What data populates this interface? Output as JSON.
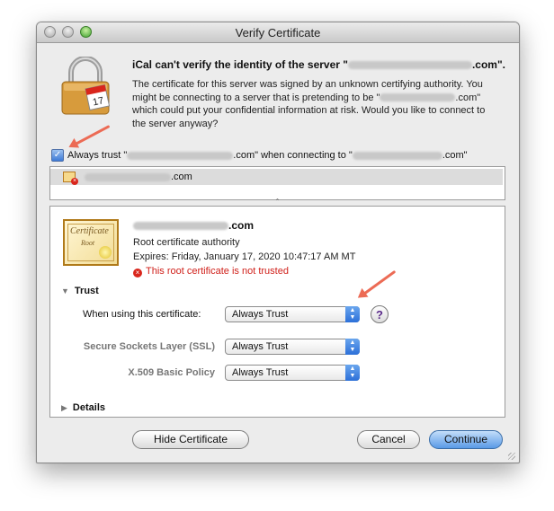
{
  "window": {
    "title": "Verify Certificate"
  },
  "header": {
    "heading_prefix": "iCal can't verify the identity of the server \"",
    "heading_suffix": ".com\".",
    "para_1": "The certificate for this server was signed by an unknown certifying authority. You might be connecting to a server that is pretending to be \"",
    "para_2": ".com\" which could put your confidential information at risk. Would you like to connect to the server anyway?"
  },
  "always_trust": {
    "checked": true,
    "prefix": "Always trust \"",
    "middle": ".com\" when connecting to \"",
    "suffix": ".com\""
  },
  "chain": {
    "item_suffix": ".com"
  },
  "certificate": {
    "name_suffix": ".com",
    "icon_title": "Certificate",
    "icon_root": "Root",
    "type": "Root certificate authority",
    "expires": "Expires: Friday, January 17, 2020 10:47:17 AM MT",
    "status": "This root certificate is not trusted",
    "status_color": "#d0201a"
  },
  "trust": {
    "section_label": "Trust",
    "when_label": "When using this certificate:",
    "when_value": "Always Trust",
    "ssl_label": "Secure Sockets Layer (SSL)",
    "ssl_value": "Always Trust",
    "x509_label": "X.509 Basic Policy",
    "x509_value": "Always Trust"
  },
  "details": {
    "section_label": "Details"
  },
  "buttons": {
    "hide_certificate": "Hide Certificate",
    "cancel": "Cancel",
    "continue": "Continue"
  },
  "icons": {
    "lock": "lock-calendar-icon",
    "help": "help-icon",
    "annotation_arrow": "red-arrow",
    "accent": "#ec6b55"
  }
}
